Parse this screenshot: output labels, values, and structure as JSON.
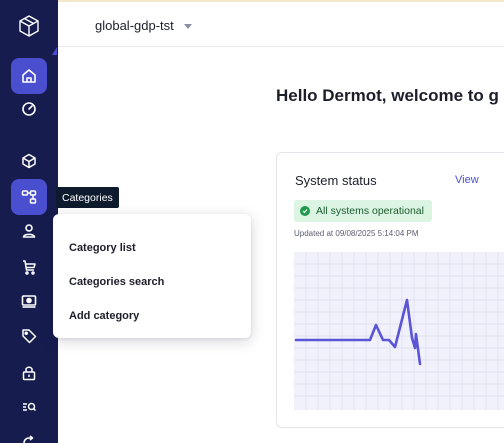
{
  "topbar": {
    "project_name": "global-gdp-tst"
  },
  "sidebar": {
    "items": [
      {
        "icon": "home-icon"
      },
      {
        "icon": "gauge-icon"
      },
      {
        "icon": "cube-icon"
      },
      {
        "icon": "categories-icon",
        "label": "Categories"
      },
      {
        "icon": "user-icon"
      },
      {
        "icon": "cart-icon"
      },
      {
        "icon": "payment-icon"
      },
      {
        "icon": "tag-icon"
      },
      {
        "icon": "lock-icon"
      },
      {
        "icon": "search-list-icon"
      },
      {
        "icon": "refresh-icon"
      }
    ]
  },
  "tooltip": {
    "text": "Categories"
  },
  "menu": {
    "items": [
      "Category list",
      "Categories search",
      "Add category"
    ]
  },
  "main": {
    "welcome": "Hello Dermot, welcome to g"
  },
  "system_status": {
    "title": "System status",
    "link": "View",
    "badge": "All systems operational",
    "updated": "Updated at 09/08/2025 5:14:04 PM"
  },
  "colors": {
    "sidebar": "#161c4e",
    "accent": "#4a4fcf",
    "success_bg": "#dcf5e3",
    "success": "#1f9a4a"
  }
}
